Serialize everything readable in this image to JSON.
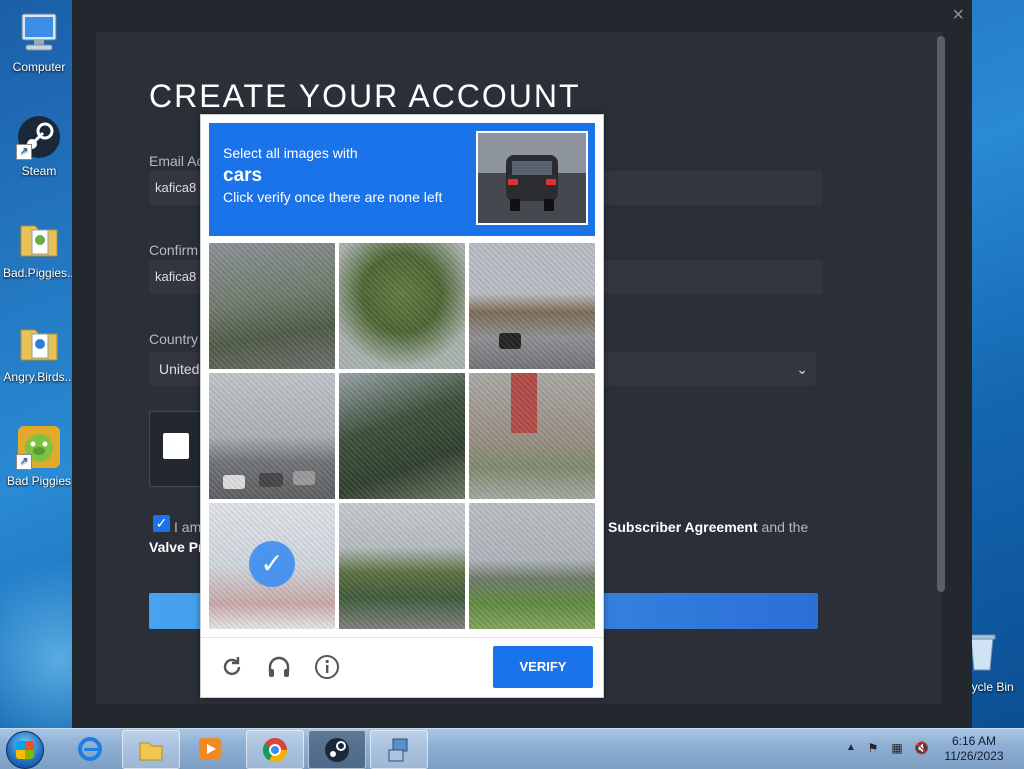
{
  "desktop": {
    "icons": [
      {
        "label": "Computer",
        "icon": "computer-icon"
      },
      {
        "label": "Steam",
        "icon": "steam-icon"
      },
      {
        "label": "Bad.Piggies...",
        "icon": "folder-icon"
      },
      {
        "label": "Angry.Birds...",
        "icon": "folder-icon"
      },
      {
        "label": "Bad Piggies",
        "icon": "bad-piggies-icon"
      },
      {
        "label": "Recycle Bin",
        "icon": "recycle-bin-icon"
      }
    ]
  },
  "steam": {
    "close_glyph": "×",
    "title": "CREATE YOUR ACCOUNT",
    "email_label": "Email Ac",
    "email_value": "kafica8",
    "confirm_label": "Confirm",
    "confirm_value": "kafica8",
    "country_label": "Country",
    "country_value": "United",
    "agree_prefix": "I am",
    "agree_link": "Subscriber Agreement",
    "agree_suffix": "and the",
    "agree_line2": "Valve Pr"
  },
  "captcha": {
    "instruction": "Select all images with",
    "target_word": "cars",
    "hint": "Click verify once there are none left",
    "verify_label": "VERIFY",
    "selected_tiles": [
      6
    ],
    "accent_color": "#1a73e8"
  },
  "taskbar": {
    "apps": [
      {
        "name": "internet-explorer-icon"
      },
      {
        "name": "file-explorer-icon"
      },
      {
        "name": "media-player-icon"
      },
      {
        "name": "chrome-icon"
      },
      {
        "name": "steam-icon"
      },
      {
        "name": "network-install-icon"
      }
    ],
    "time": "6:16 AM",
    "date": "11/26/2023"
  }
}
